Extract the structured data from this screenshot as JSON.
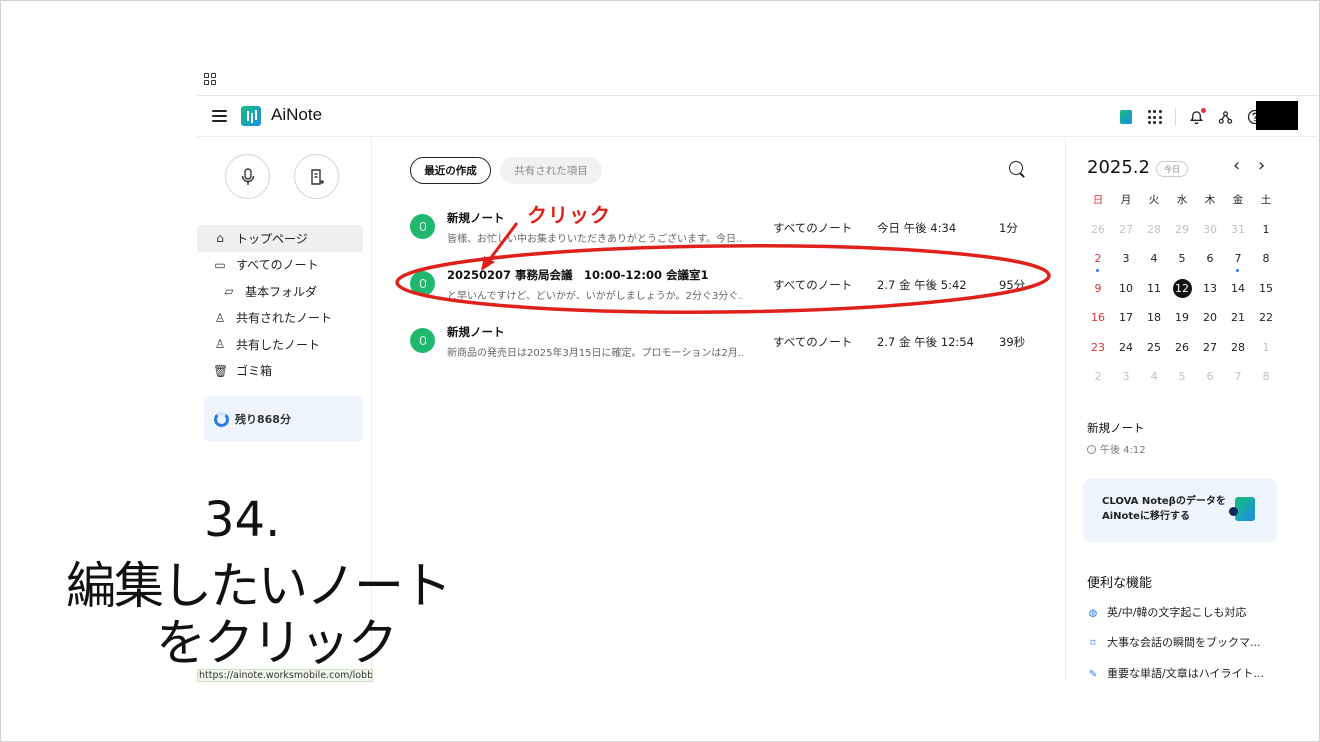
{
  "app": {
    "title": "AiNote"
  },
  "sidebar": {
    "items": [
      {
        "label": "トップページ"
      },
      {
        "label": "すべてのノート"
      },
      {
        "label": "基本フォルダ"
      },
      {
        "label": "共有されたノート"
      },
      {
        "label": "共有したノート"
      },
      {
        "label": "ゴミ箱"
      }
    ],
    "remaining": "残り868分"
  },
  "status_url": "https://ainote.worksmobile.com/lobby",
  "main": {
    "tabs": [
      {
        "label": "最近の作成"
      },
      {
        "label": "共有された項目"
      }
    ],
    "notes": [
      {
        "title": "新規ノート",
        "snippet": "皆様、お忙しい中お集まりいただきありがとうございます。今日...",
        "folder": "すべてのノート",
        "date": "今日 午後 4:34",
        "duration": "1分"
      },
      {
        "title": "20250207 事務局会議　10:00-12:00 会議室1",
        "snippet": "と早いんですけど、どいかが、いかがしましょうか。2分ぐ3分ぐ...",
        "folder": "すべてのノート",
        "date": "2.7 金 午後 5:42",
        "duration": "95分"
      },
      {
        "title": "新規ノート",
        "snippet": "新商品の発売日は2025年3月15日に確定。プロモーションは2月...",
        "folder": "すべてのノート",
        "date": "2.7 金 午後 12:54",
        "duration": "39秒"
      }
    ]
  },
  "calendar": {
    "title": "2025.2",
    "today_label": "今日",
    "prev": "‹",
    "next": "›",
    "weekdays": [
      "日",
      "月",
      "火",
      "水",
      "木",
      "金",
      "土"
    ],
    "weeks": [
      [
        "26",
        "27",
        "28",
        "29",
        "30",
        "31",
        "1"
      ],
      [
        "2",
        "3",
        "4",
        "5",
        "6",
        "7",
        "8"
      ],
      [
        "9",
        "10",
        "11",
        "12",
        "13",
        "14",
        "15"
      ],
      [
        "16",
        "17",
        "18",
        "19",
        "20",
        "21",
        "22"
      ],
      [
        "23",
        "24",
        "25",
        "26",
        "27",
        "28",
        "1"
      ],
      [
        "2",
        "3",
        "4",
        "5",
        "6",
        "7",
        "8"
      ]
    ],
    "selected_day": "12",
    "event": {
      "title": "新規ノート",
      "time": "午後 4:12"
    }
  },
  "promo": {
    "line1": "CLOVA Noteβのデータを",
    "line2": "AiNoteに移行する"
  },
  "features": {
    "heading": "便利な機能",
    "items": [
      {
        "label": "英/中/韓の文字起こしも対応",
        "icon": "globe-icon"
      },
      {
        "label": "大事な会話の瞬間をブックマ...",
        "icon": "bookmark-icon"
      },
      {
        "label": "重要な単語/文章はハイライト...",
        "icon": "highlight-icon"
      }
    ]
  },
  "annotation": {
    "label": "クリック",
    "color": "#e0201a"
  },
  "caption": {
    "number": "34.",
    "line1": "編集したいノート",
    "line2": "をクリック"
  },
  "colors": {
    "accent": "#1fb86d",
    "annotation": "#e0201a",
    "calendar_sunday": "#d9353c",
    "link_blue": "#2a7de1"
  }
}
